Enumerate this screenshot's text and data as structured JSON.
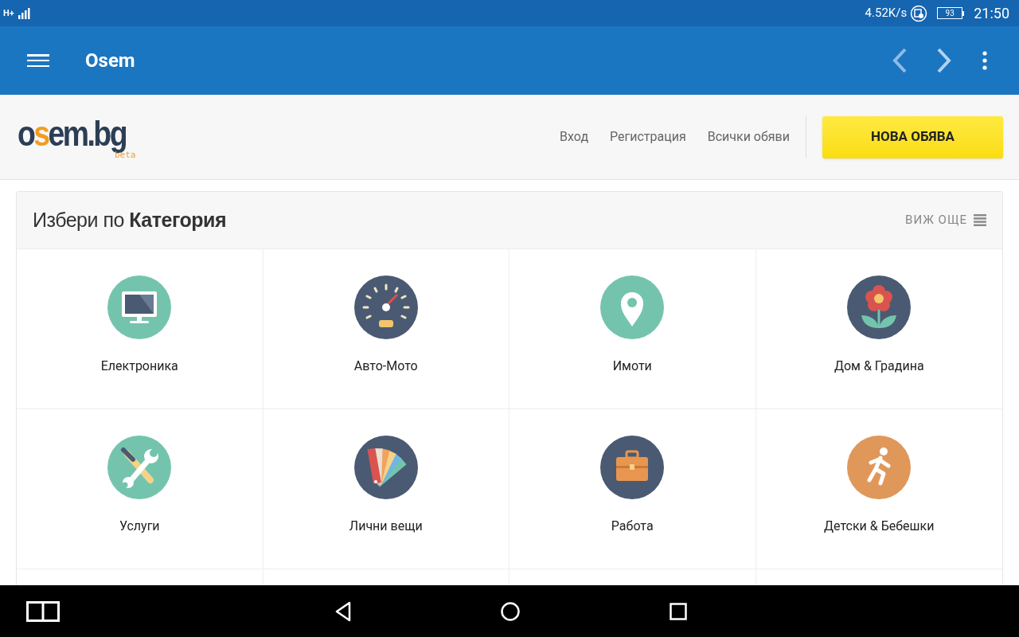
{
  "status_bar": {
    "network": "H+",
    "speed": "4.52K/s",
    "battery": "93",
    "time": "21:50"
  },
  "app_bar": {
    "title": "Osem"
  },
  "site_header": {
    "logo": "osem.bg",
    "logo_badge": "beta",
    "links": [
      "Вход",
      "Регистрация",
      "Всички обяви"
    ],
    "cta": "НОВА ОБЯВА"
  },
  "categories_card": {
    "title": "Избери по **Категория**",
    "more": "ВИЖ ОЩЕ",
    "items": [
      {
        "label": "Електроника"
      },
      {
        "label": "Авто-Мото"
      },
      {
        "label": "Имоти"
      },
      {
        "label": "Дом & Градина"
      },
      {
        "label": "Услуги"
      },
      {
        "label": "Лични вещи"
      },
      {
        "label": "Работа"
      },
      {
        "label": "Детски & Бебешки"
      }
    ]
  }
}
